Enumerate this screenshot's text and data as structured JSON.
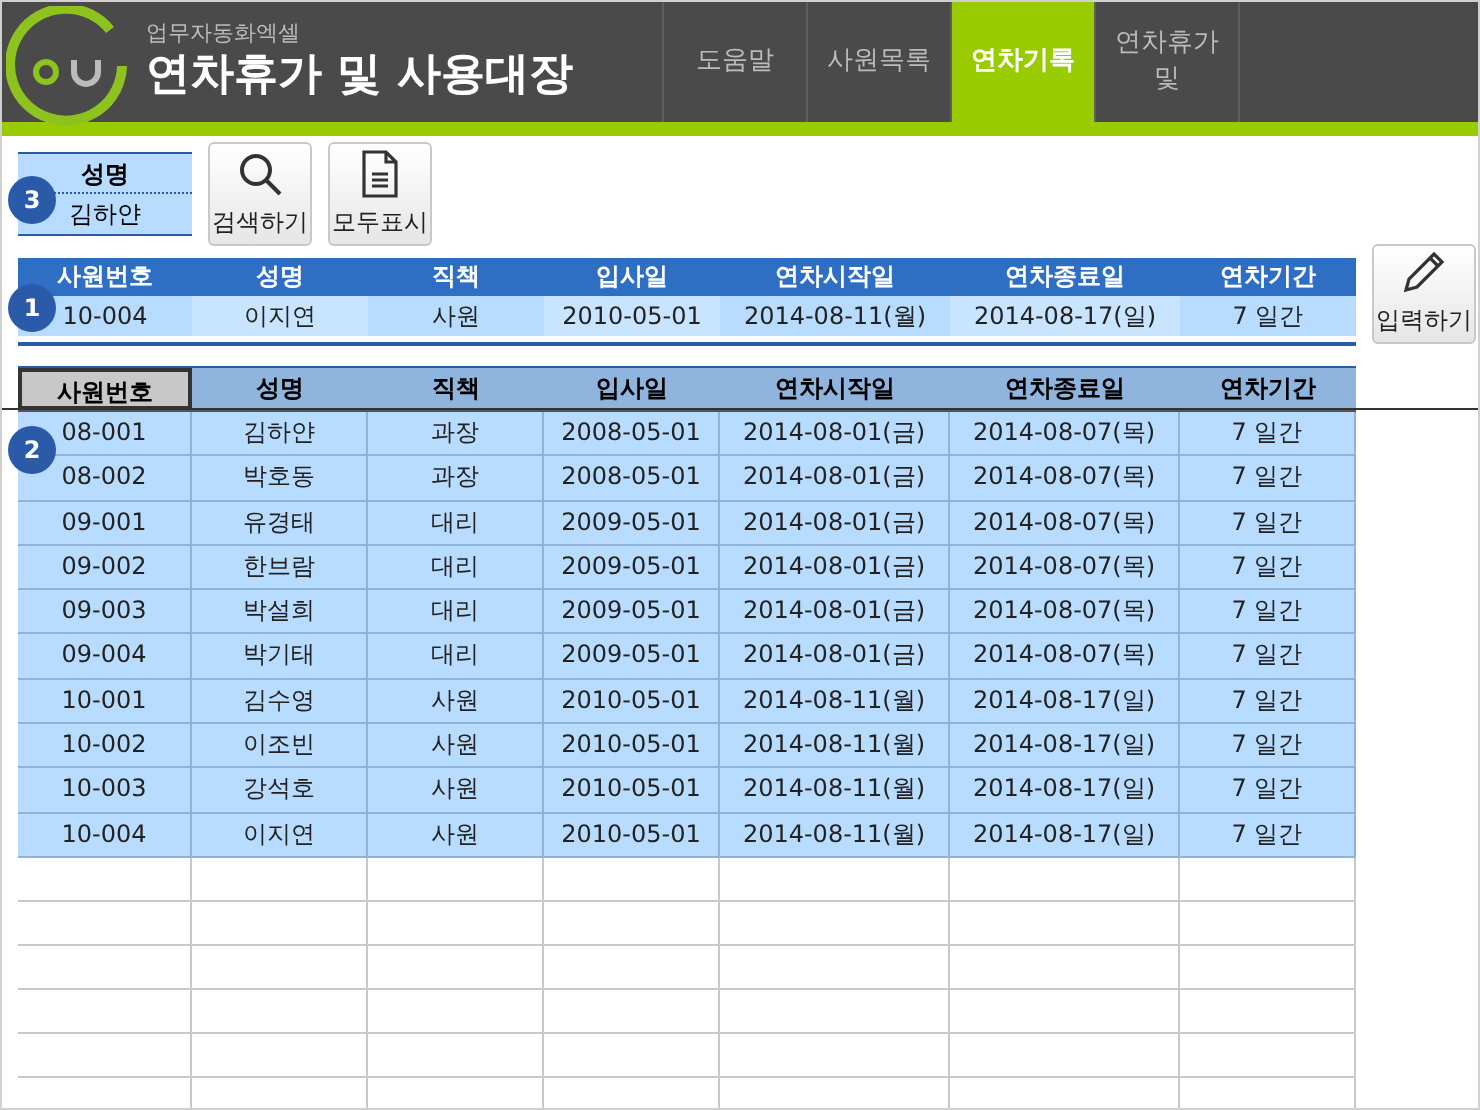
{
  "header": {
    "subtitle": "업무자동화엑셀",
    "title": "연차휴가 및 사용대장"
  },
  "tabs": [
    {
      "label": "도움말",
      "selected": false
    },
    {
      "label": "사원목록",
      "selected": false
    },
    {
      "label": "연차기록",
      "selected": true
    },
    {
      "label": "연차휴가 및",
      "selected": false
    }
  ],
  "filter": {
    "badge": "3",
    "label": "성명",
    "value": "김하얀"
  },
  "buttons": [
    {
      "kind": "search",
      "label": "검색하기"
    },
    {
      "kind": "document",
      "label": "모두표시"
    }
  ],
  "entry": {
    "badge": "1",
    "columns": [
      "사원번호",
      "성명",
      "직책",
      "입사일",
      "연차시작일",
      "연차종료일",
      "연차기간"
    ],
    "row": [
      "10-004",
      "이지연",
      "사원",
      "2010-05-01",
      "2014-08-11(월)",
      "2014-08-17(일)",
      "7 일간"
    ],
    "button": {
      "kind": "pencil",
      "label": "입력하기"
    }
  },
  "table": {
    "badge": "2",
    "columns": [
      {
        "label": "사원번호",
        "selected": true
      },
      {
        "label": "성명",
        "selected": false
      },
      {
        "label": "직책",
        "selected": false
      },
      {
        "label": "입사일",
        "selected": false
      },
      {
        "label": "연차시작일",
        "selected": false
      },
      {
        "label": "연차종료일",
        "selected": false
      },
      {
        "label": "연차기간",
        "selected": false
      }
    ],
    "rows": [
      [
        "08-001",
        "김하얀",
        "과장",
        "2008-05-01",
        "2014-08-01(금)",
        "2014-08-07(목)",
        "7 일간"
      ],
      [
        "08-002",
        "박호동",
        "과장",
        "2008-05-01",
        "2014-08-01(금)",
        "2014-08-07(목)",
        "7 일간"
      ],
      [
        "09-001",
        "유경태",
        "대리",
        "2009-05-01",
        "2014-08-01(금)",
        "2014-08-07(목)",
        "7 일간"
      ],
      [
        "09-002",
        "한브람",
        "대리",
        "2009-05-01",
        "2014-08-01(금)",
        "2014-08-07(목)",
        "7 일간"
      ],
      [
        "09-003",
        "박설희",
        "대리",
        "2009-05-01",
        "2014-08-01(금)",
        "2014-08-07(목)",
        "7 일간"
      ],
      [
        "09-004",
        "박기태",
        "대리",
        "2009-05-01",
        "2014-08-01(금)",
        "2014-08-07(목)",
        "7 일간"
      ],
      [
        "10-001",
        "김수영",
        "사원",
        "2010-05-01",
        "2014-08-11(월)",
        "2014-08-17(일)",
        "7 일간"
      ],
      [
        "10-002",
        "이조빈",
        "사원",
        "2010-05-01",
        "2014-08-11(월)",
        "2014-08-17(일)",
        "7 일간"
      ],
      [
        "10-003",
        "강석호",
        "사원",
        "2010-05-01",
        "2014-08-11(월)",
        "2014-08-17(일)",
        "7 일간"
      ],
      [
        "10-004",
        "이지연",
        "사원",
        "2010-05-01",
        "2014-08-11(월)",
        "2014-08-17(일)",
        "7 일간"
      ]
    ]
  }
}
